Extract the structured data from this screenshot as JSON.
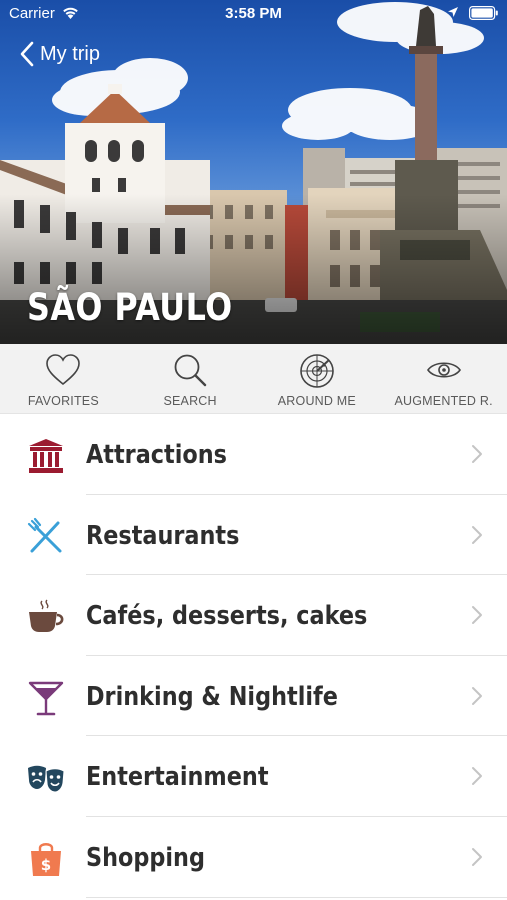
{
  "status_bar": {
    "carrier": "Carrier",
    "time": "3:58 PM"
  },
  "header": {
    "back_label": "My trip",
    "city_title": "SÃO PAULO"
  },
  "toolbar": {
    "items": [
      {
        "label": "FAVORITES",
        "icon": "heart-icon"
      },
      {
        "label": "SEARCH",
        "icon": "search-icon"
      },
      {
        "label": "AROUND ME",
        "icon": "radar-icon"
      },
      {
        "label": "AUGMENTED R.",
        "icon": "eye-icon"
      }
    ]
  },
  "categories": [
    {
      "label": "Attractions",
      "icon": "museum-icon",
      "color": "#9b1b30"
    },
    {
      "label": "Restaurants",
      "icon": "fork-knife-icon",
      "color": "#3aa0d8"
    },
    {
      "label": "Cafés, desserts, cakes",
      "icon": "coffee-cup-icon",
      "color": "#6b4a3e"
    },
    {
      "label": "Drinking & Nightlife",
      "icon": "cocktail-icon",
      "color": "#7a3a7a"
    },
    {
      "label": "Entertainment",
      "icon": "theater-masks-icon",
      "color": "#23475e"
    },
    {
      "label": "Shopping",
      "icon": "shopping-bag-icon",
      "color": "#f07a4f"
    }
  ]
}
